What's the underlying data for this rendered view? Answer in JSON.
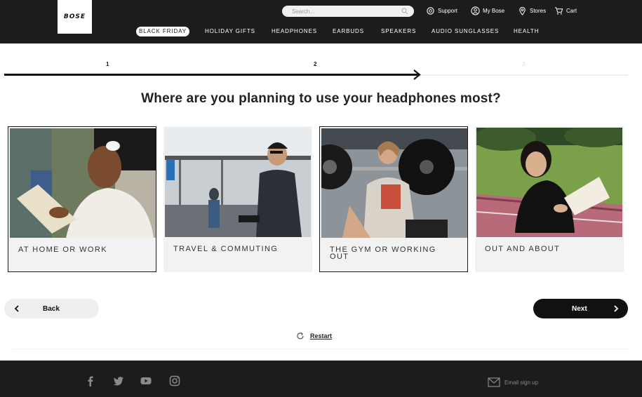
{
  "header": {
    "logo_text": "BOSE",
    "search_placeholder": "Search...",
    "utility": [
      {
        "label": "Support",
        "icon": "support-icon"
      },
      {
        "label": "My Bose",
        "icon": "user-icon"
      },
      {
        "label": "Stores",
        "icon": "location-pin-icon"
      },
      {
        "label": "Cart",
        "icon": "cart-icon"
      }
    ],
    "nav": [
      "BLACK FRIDAY",
      "HOLIDAY GIFTS",
      "HEADPHONES",
      "EARBUDS",
      "SPEAKERS",
      "AUDIO SUNGLASSES",
      "HEALTH"
    ]
  },
  "progress": {
    "steps": [
      "1",
      "2",
      "3"
    ],
    "current_step": 2
  },
  "question": "Where are you planning to use your headphones most?",
  "options": [
    {
      "label": "AT HOME OR WORK",
      "selected": true
    },
    {
      "label": "TRAVEL & COMMUTING",
      "selected": false
    },
    {
      "label": "THE GYM OR WORKING OUT",
      "selected": true
    },
    {
      "label": "OUT AND ABOUT",
      "selected": false
    }
  ],
  "buttons": {
    "back": "Back",
    "next": "Next",
    "restart": "Restart"
  },
  "footer": {
    "social": [
      "facebook-icon",
      "twitter-icon",
      "youtube-icon",
      "instagram-icon"
    ],
    "email_signup": "Email sign up"
  },
  "colors": {
    "header_bg": "#1c1c1c",
    "card_bg": "#f2f2f2",
    "next_button_bg": "#111111"
  }
}
